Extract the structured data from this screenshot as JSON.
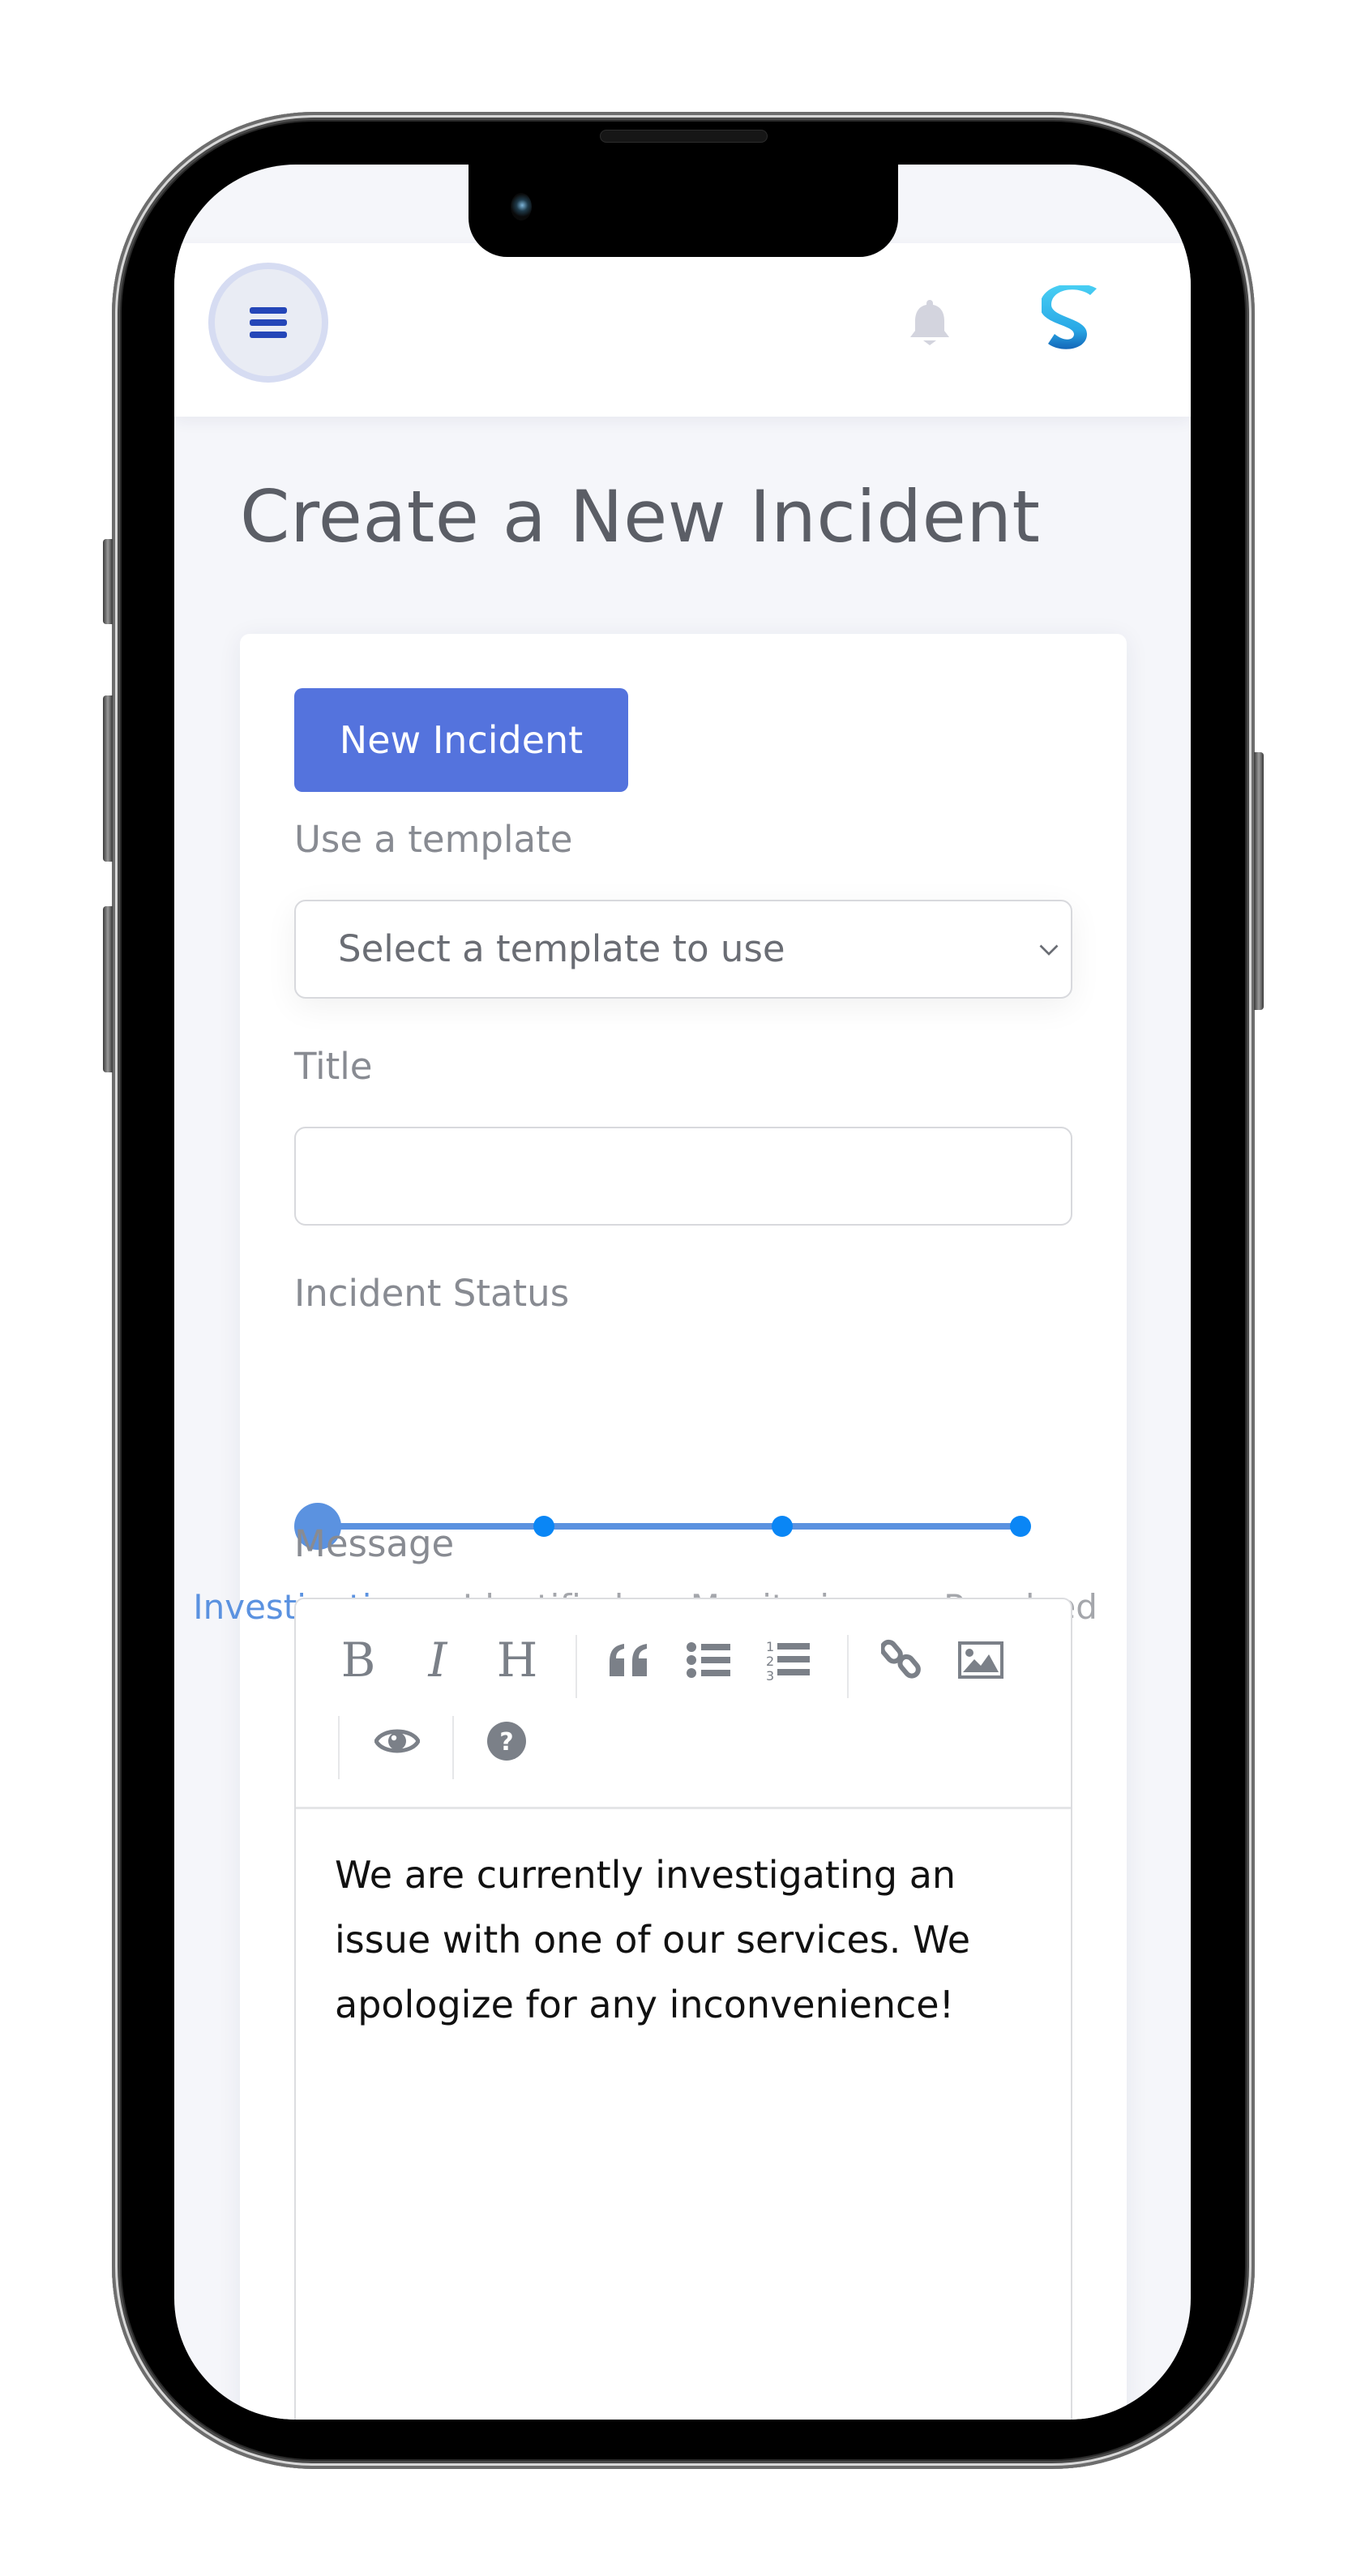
{
  "header": {
    "menu_icon": "hamburger-menu-icon",
    "notification_icon": "bell-icon",
    "logo_icon": "s-logo-icon"
  },
  "page": {
    "title": "Create a New Incident"
  },
  "form": {
    "new_incident_button": "New Incident",
    "template_label": "Use a template",
    "template_select": {
      "selected_value": "Select a template to use",
      "icon": "chevron-down-icon"
    },
    "title_label": "Title",
    "title_value": "",
    "status_label": "Incident Status",
    "status_steps": [
      {
        "label": "Investigating",
        "active": true
      },
      {
        "label": "Identified",
        "active": false
      },
      {
        "label": "Monitoring",
        "active": false
      },
      {
        "label": "Resolved",
        "active": false
      }
    ],
    "status_selected_index": 0,
    "message_label": "Message",
    "editor_toolbar": [
      {
        "icon": "bold-icon",
        "glyph": "B"
      },
      {
        "icon": "italic-icon",
        "glyph": "I"
      },
      {
        "icon": "heading-icon",
        "glyph": "H"
      },
      {
        "icon": "quote-icon",
        "glyph": "“"
      },
      {
        "icon": "unordered-list-icon",
        "glyph": ""
      },
      {
        "icon": "ordered-list-icon",
        "glyph": ""
      },
      {
        "icon": "link-icon",
        "glyph": ""
      },
      {
        "icon": "image-icon",
        "glyph": ""
      },
      {
        "icon": "preview-eye-icon",
        "glyph": ""
      },
      {
        "icon": "help-icon",
        "glyph": "?"
      }
    ],
    "message_value": "We are currently investigating an issue with one of our services. We apologize for any inconvenience!"
  },
  "colors": {
    "primary_button": "#5473dd",
    "slider_accent": "#5b92e0",
    "slider_dot": "#0a86f5",
    "menu_icon": "#2446b8",
    "page_background": "#f5f6fa"
  }
}
